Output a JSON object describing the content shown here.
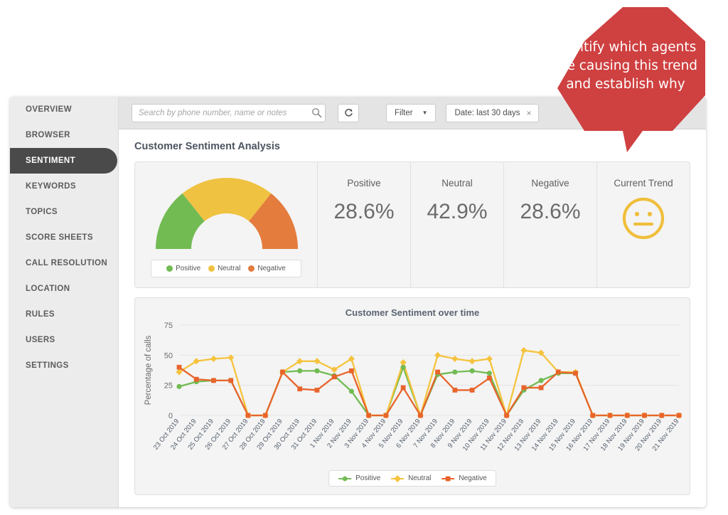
{
  "sidebar": {
    "items": [
      {
        "label": "OVERVIEW",
        "active": false
      },
      {
        "label": "BROWSER",
        "active": false
      },
      {
        "label": "SENTIMENT",
        "active": true
      },
      {
        "label": "KEYWORDS",
        "active": false
      },
      {
        "label": "TOPICS",
        "active": false
      },
      {
        "label": "SCORE SHEETS",
        "active": false
      },
      {
        "label": "CALL RESOLUTION",
        "active": false
      },
      {
        "label": "LOCATION",
        "active": false
      },
      {
        "label": "RULES",
        "active": false
      },
      {
        "label": "USERS",
        "active": false
      },
      {
        "label": "SETTINGS",
        "active": false
      }
    ]
  },
  "toolbar": {
    "search_placeholder": "Search by phone number, name or notes",
    "search_value": "",
    "search_icon": "search-icon",
    "refresh_icon": "refresh-icon",
    "filter_label": "Filter",
    "filter_caret": "▼",
    "date_chip_label": "Date: last 30 days",
    "date_chip_remove": "×"
  },
  "page": {
    "title": "Customer Sentiment Analysis"
  },
  "summary": {
    "gauge": {
      "segments": [
        {
          "label": "Positive",
          "value": 28.6,
          "color": "#72bb53"
        },
        {
          "label": "Neutral",
          "value": 42.9,
          "color": "#f0c241"
        },
        {
          "label": "Negative",
          "value": 28.6,
          "color": "#e47c3e"
        }
      ],
      "legend": [
        {
          "label": "Positive",
          "color": "#72bb53"
        },
        {
          "label": "Neutral",
          "color": "#f0c241"
        },
        {
          "label": "Negative",
          "color": "#e47c3e"
        }
      ]
    },
    "kpis": [
      {
        "label": "Positive",
        "value": "28.6%"
      },
      {
        "label": "Neutral",
        "value": "42.9%"
      },
      {
        "label": "Negative",
        "value": "28.6%"
      }
    ],
    "trend": {
      "label": "Current Trend",
      "icon": "neutral-face-icon",
      "color": "#f0be3c"
    }
  },
  "callout": {
    "text": "Identify which agents are causing this trend and establish why",
    "color": "#cf4040"
  },
  "chart_data": {
    "type": "line",
    "title": "Customer Sentiment over time",
    "xlabel": "",
    "ylabel": "Percentage of calls",
    "ylim": [
      0,
      75
    ],
    "yticks": [
      0,
      25,
      50,
      75
    ],
    "grid": true,
    "legend_position": "bottom",
    "categories": [
      "23 Oct 2019",
      "24 Oct 2019",
      "25 Oct 2019",
      "26 Oct 2019",
      "27 Oct 2019",
      "28 Oct 2019",
      "29 Oct 2019",
      "30 Oct 2019",
      "31 Oct 2019",
      "1 Nov 2019",
      "2 Nov 2019",
      "3 Nov 2019",
      "4 Nov 2019",
      "5 Nov 2019",
      "6 Nov 2019",
      "7 Nov 2019",
      "8 Nov 2019",
      "9 Nov 2019",
      "10 Nov 2019",
      "11 Nov 2019",
      "12 Nov 2019",
      "13 Nov 2019",
      "14 Nov 2019",
      "15 Nov 2019",
      "16 Nov 2019",
      "17 Nov 2019",
      "18 Nov 2019",
      "19 Nov 2019",
      "20 Nov 2019",
      "21 Nov 2019"
    ],
    "series": [
      {
        "name": "Positive",
        "color": "#72bb53",
        "marker": "circle",
        "values": [
          24,
          28,
          29,
          29,
          0,
          0,
          36,
          37,
          37,
          33,
          20,
          0,
          0,
          40,
          0,
          34,
          36,
          37,
          35,
          0,
          21,
          29,
          35,
          35,
          0,
          0,
          0,
          0,
          0,
          0
        ]
      },
      {
        "name": "Neutral",
        "color": "#f5c33e",
        "marker": "diamond",
        "values": [
          36,
          45,
          47,
          48,
          0,
          0,
          36,
          45,
          45,
          38,
          47,
          0,
          0,
          44,
          0,
          50,
          47,
          45,
          47,
          0,
          54,
          52,
          36,
          36,
          0,
          0,
          0,
          0,
          0,
          0
        ]
      },
      {
        "name": "Negative",
        "color": "#e8642c",
        "marker": "square",
        "values": [
          40,
          30,
          29,
          29,
          0,
          0,
          36,
          22,
          21,
          32,
          37,
          0,
          0,
          23,
          0,
          36,
          21,
          21,
          31,
          0,
          23,
          23,
          36,
          35,
          0,
          0,
          0,
          0,
          0,
          0
        ]
      }
    ],
    "legend": [
      {
        "label": "Positive",
        "color": "#72bb53",
        "marker": "circle"
      },
      {
        "label": "Neutral",
        "color": "#f5c33e",
        "marker": "diamond"
      },
      {
        "label": "Negative",
        "color": "#e8642c",
        "marker": "square"
      }
    ]
  }
}
